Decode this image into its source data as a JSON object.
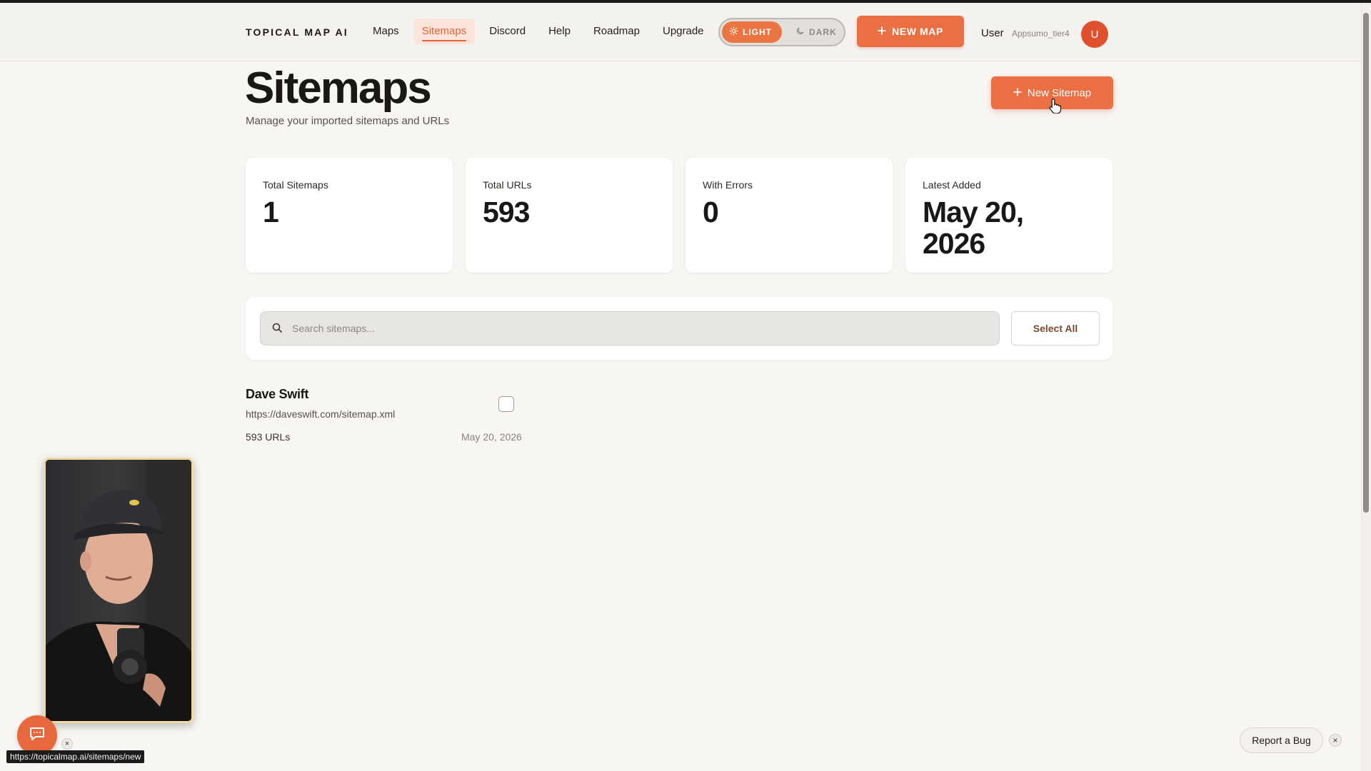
{
  "nav": {
    "brand": "TOPICAL MAP AI",
    "links": [
      {
        "label": "Maps",
        "active": false
      },
      {
        "label": "Sitemaps",
        "active": true
      },
      {
        "label": "Discord",
        "active": false
      },
      {
        "label": "Help",
        "active": false
      },
      {
        "label": "Roadmap",
        "active": false
      },
      {
        "label": "Upgrade",
        "active": false
      }
    ],
    "theme": {
      "light": "LIGHT",
      "dark": "DARK",
      "selected": "light"
    },
    "new_map_label": "NEW MAP",
    "user_label": "User",
    "user_name": "Appsumo_tier4",
    "avatar_initial": "U"
  },
  "page": {
    "title": "Sitemaps",
    "subtitle": "Manage your imported sitemaps and URLs",
    "new_sitemap_label": "New Sitemap"
  },
  "stats": [
    {
      "label": "Total Sitemaps",
      "value": "1"
    },
    {
      "label": "Total URLs",
      "value": "593"
    },
    {
      "label": "With Errors",
      "value": "0"
    },
    {
      "label": "Latest Added",
      "value": "May 20, 2026"
    }
  ],
  "search": {
    "placeholder": "Search sitemaps...",
    "value": "",
    "select_all_label": "Select All"
  },
  "sitemaps": [
    {
      "name": "Dave Swift",
      "url": "https://daveswift.com/sitemap.xml",
      "url_count": "593 URLs",
      "date": "May 20, 2026",
      "checked": false
    }
  ],
  "footer": {
    "status_url": "https://topicalmap.ai/sitemaps/new",
    "report_bug_label": "Report a Bug",
    "close_glyph": "×"
  },
  "colors": {
    "accent": "#ea6f43",
    "accent_dark": "#e0633a",
    "background": "#f8f6f3"
  },
  "icons": [
    "sun-icon",
    "moon-icon",
    "plus-icon",
    "search-icon",
    "chat-icon",
    "close-icon",
    "pointer-cursor-icon"
  ]
}
